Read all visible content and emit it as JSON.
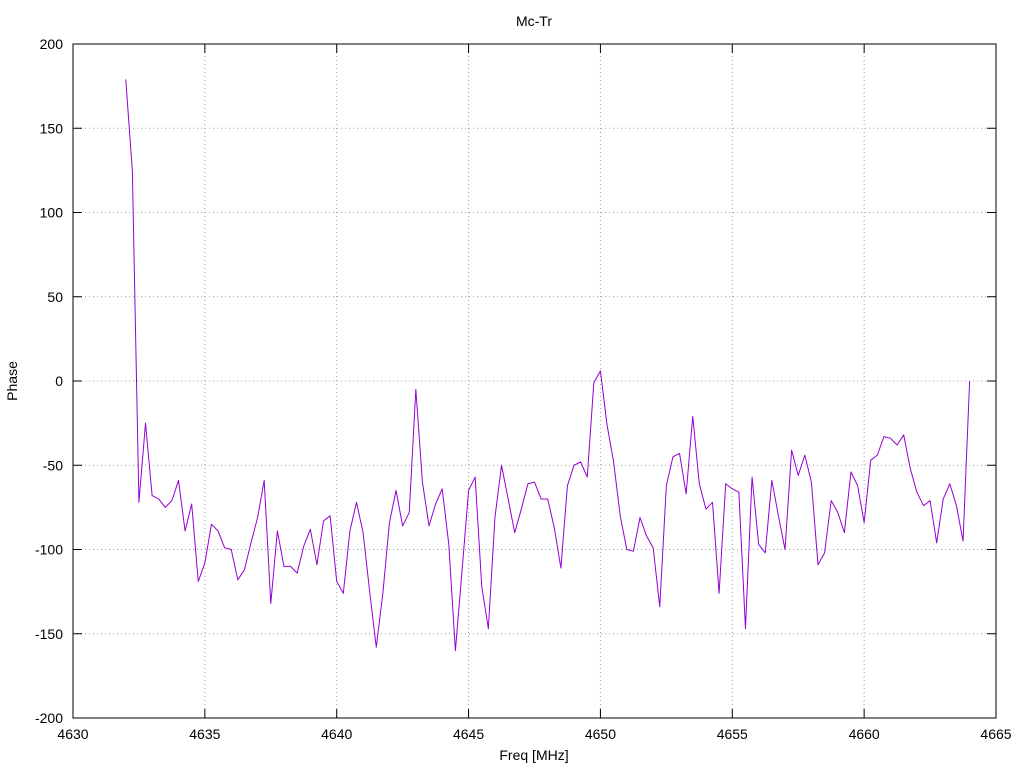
{
  "chart_data": {
    "type": "line",
    "title": "Mc-Tr",
    "xlabel": "Freq [MHz]",
    "ylabel": "Phase",
    "xlim": [
      4630,
      4665
    ],
    "ylim": [
      -200,
      200
    ],
    "xticks": [
      4630,
      4635,
      4640,
      4645,
      4650,
      4655,
      4660,
      4665
    ],
    "yticks": [
      -200,
      -150,
      -100,
      -50,
      0,
      50,
      100,
      150,
      200
    ],
    "grid": true,
    "line_color": "#9400d3",
    "series": [
      {
        "x": [
          4632.0,
          4632.25,
          4632.5,
          4632.75,
          4633.0,
          4633.25,
          4633.5,
          4633.75,
          4634.0,
          4634.25,
          4634.5,
          4634.75,
          4635.0,
          4635.25,
          4635.5,
          4635.75,
          4636.0,
          4636.25,
          4636.5,
          4636.75,
          4637.0,
          4637.25,
          4637.5,
          4637.75,
          4638.0,
          4638.25,
          4638.5,
          4638.75,
          4639.0,
          4639.25,
          4639.5,
          4639.75,
          4640.0,
          4640.25,
          4640.5,
          4640.75,
          4641.0,
          4641.25,
          4641.5,
          4641.75,
          4642.0,
          4642.25,
          4642.5,
          4642.75,
          4643.0,
          4643.25,
          4643.5,
          4643.75,
          4644.0,
          4644.25,
          4644.5,
          4644.75,
          4645.0,
          4645.25,
          4645.5,
          4645.75,
          4646.0,
          4646.25,
          4646.5,
          4646.75,
          4647.0,
          4647.25,
          4647.5,
          4647.75,
          4648.0,
          4648.25,
          4648.5,
          4648.75,
          4649.0,
          4649.25,
          4649.5,
          4649.75,
          4650.0,
          4650.25,
          4650.5,
          4650.75,
          4651.0,
          4651.25,
          4651.5,
          4651.75,
          4652.0,
          4652.25,
          4652.5,
          4652.75,
          4653.0,
          4653.25,
          4653.5,
          4653.75,
          4654.0,
          4654.25,
          4654.5,
          4654.75,
          4655.0,
          4655.25,
          4655.5,
          4655.75,
          4656.0,
          4656.25,
          4656.5,
          4656.75,
          4657.0,
          4657.25,
          4657.5,
          4657.75,
          4658.0,
          4658.25,
          4658.5,
          4658.75,
          4659.0,
          4659.25,
          4659.5,
          4659.75,
          4660.0,
          4660.25,
          4660.5,
          4660.75,
          4661.0,
          4661.25,
          4661.5,
          4661.75,
          4662.0,
          4662.25,
          4662.5,
          4662.75,
          4663.0,
          4663.25,
          4663.5,
          4663.75,
          4664.0
        ],
        "y": [
          179,
          125,
          -72,
          -25,
          -68,
          -70,
          -75,
          -71,
          -59,
          -89,
          -73,
          -119,
          -108,
          -85,
          -89,
          -99,
          -100,
          -118,
          -112,
          -96,
          -81,
          -59,
          -132,
          -89,
          -110,
          -110,
          -114,
          -98,
          -88,
          -109,
          -83,
          -80,
          -119,
          -126,
          -89,
          -72,
          -90,
          -125,
          -158,
          -126,
          -84,
          -65,
          -86,
          -78,
          -5,
          -60,
          -86,
          -73,
          -64,
          -97,
          -160,
          -113,
          -65,
          -57,
          -122,
          -147,
          -81,
          -50,
          -70,
          -90,
          -76,
          -61,
          -60,
          -70,
          -70,
          -87,
          -111,
          -62,
          -50,
          -48,
          -57,
          -1,
          6,
          -26,
          -48,
          -80,
          -100,
          -101,
          -81,
          -92,
          -99,
          -134,
          -62,
          -45,
          -43,
          -67,
          -21,
          -61,
          -76,
          -72,
          -126,
          -61,
          -64,
          -66,
          -147,
          -57,
          -97,
          -102,
          -59,
          -80,
          -100,
          -41,
          -56,
          -44,
          -60,
          -109,
          -102,
          -71,
          -78,
          -90,
          -54,
          -62,
          -84,
          -47,
          -44,
          -33,
          -34,
          -38,
          -32,
          -52,
          -66,
          -74,
          -71,
          -96,
          -70,
          -61,
          -74,
          -95,
          0
        ]
      }
    ]
  }
}
